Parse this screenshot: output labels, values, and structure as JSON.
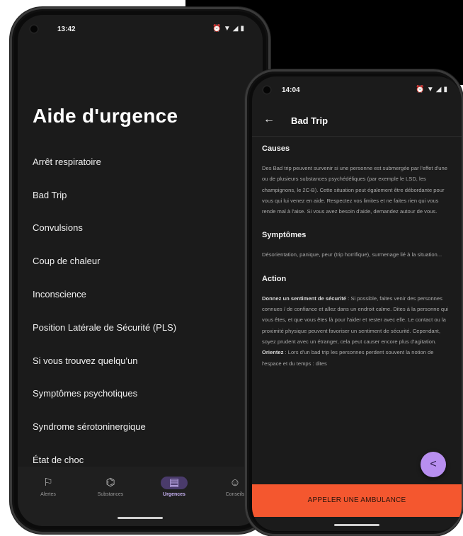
{
  "phone1": {
    "status": {
      "time": "13:42",
      "icons": [
        "alarm-icon",
        "wifi-icon",
        "signal-icon",
        "battery-icon"
      ]
    },
    "title": "Aide d'urgence",
    "items": [
      "Arrêt respiratoire",
      "Bad Trip",
      "Convulsions",
      "Coup de chaleur",
      "Inconscience",
      "Position Latérale de Sécurité (PLS)",
      "Si vous trouvez quelqu'un",
      "Symptômes psychotiques",
      "Syndrome sérotoninergique",
      "État de choc"
    ],
    "nav": [
      {
        "label": "Alertes",
        "icon": "flag-icon",
        "glyph": "⚐"
      },
      {
        "label": "Substances",
        "icon": "molecule-icon",
        "glyph": "⌬"
      },
      {
        "label": "Urgences",
        "icon": "clipboard-icon",
        "glyph": "▤"
      },
      {
        "label": "Conseils",
        "icon": "smile-icon",
        "glyph": "☺"
      }
    ]
  },
  "phone2": {
    "status": {
      "time": "14:04",
      "icons": [
        "alarm-icon",
        "wifi-icon",
        "signal-icon",
        "battery-icon"
      ]
    },
    "title": "Bad Trip",
    "sections": [
      {
        "title": "Causes",
        "text": "Des Bad trip peuvent survenir si une personne est submergée par l'effet d'une ou de plusieurs substances psychédéliques (par exemple le LSD, les champignons, le 2C-B). Cette situation peut également être débordante pour vous qui lui venez en aide. Respectez vos limites et ne faites rien qui vous rende mal à l'aise. Si vous avez besoin d'aide, demandez autour de vous."
      },
      {
        "title": "Symptômes",
        "text": "Désorientation, panique, peur (trip horrifique), surmenage lié à la situation..."
      },
      {
        "title": "Action",
        "lead": "Donnez un sentiment de sécurité",
        "text": " : Si possible, faites venir des personnes connues / de confiance et allez dans un endroit calme. Dites à la personne qui vous êtes, et que vous êtes là pour l'aider et rester avec elle. Le contact ou la proximité physique peuvent favoriser un sentiment de sécurité. Cependant, soyez prudent avec un étranger, cela peut causer encore plus d'agitation.",
        "lead2": "Orientez",
        "text2": " : Lors d'un bad trip les personnes perdent souvent la notion de l'espace et du temps : dites"
      }
    ],
    "share_glyph": "<",
    "ambulance_label": "APPELER UNE AMBULANCE"
  }
}
